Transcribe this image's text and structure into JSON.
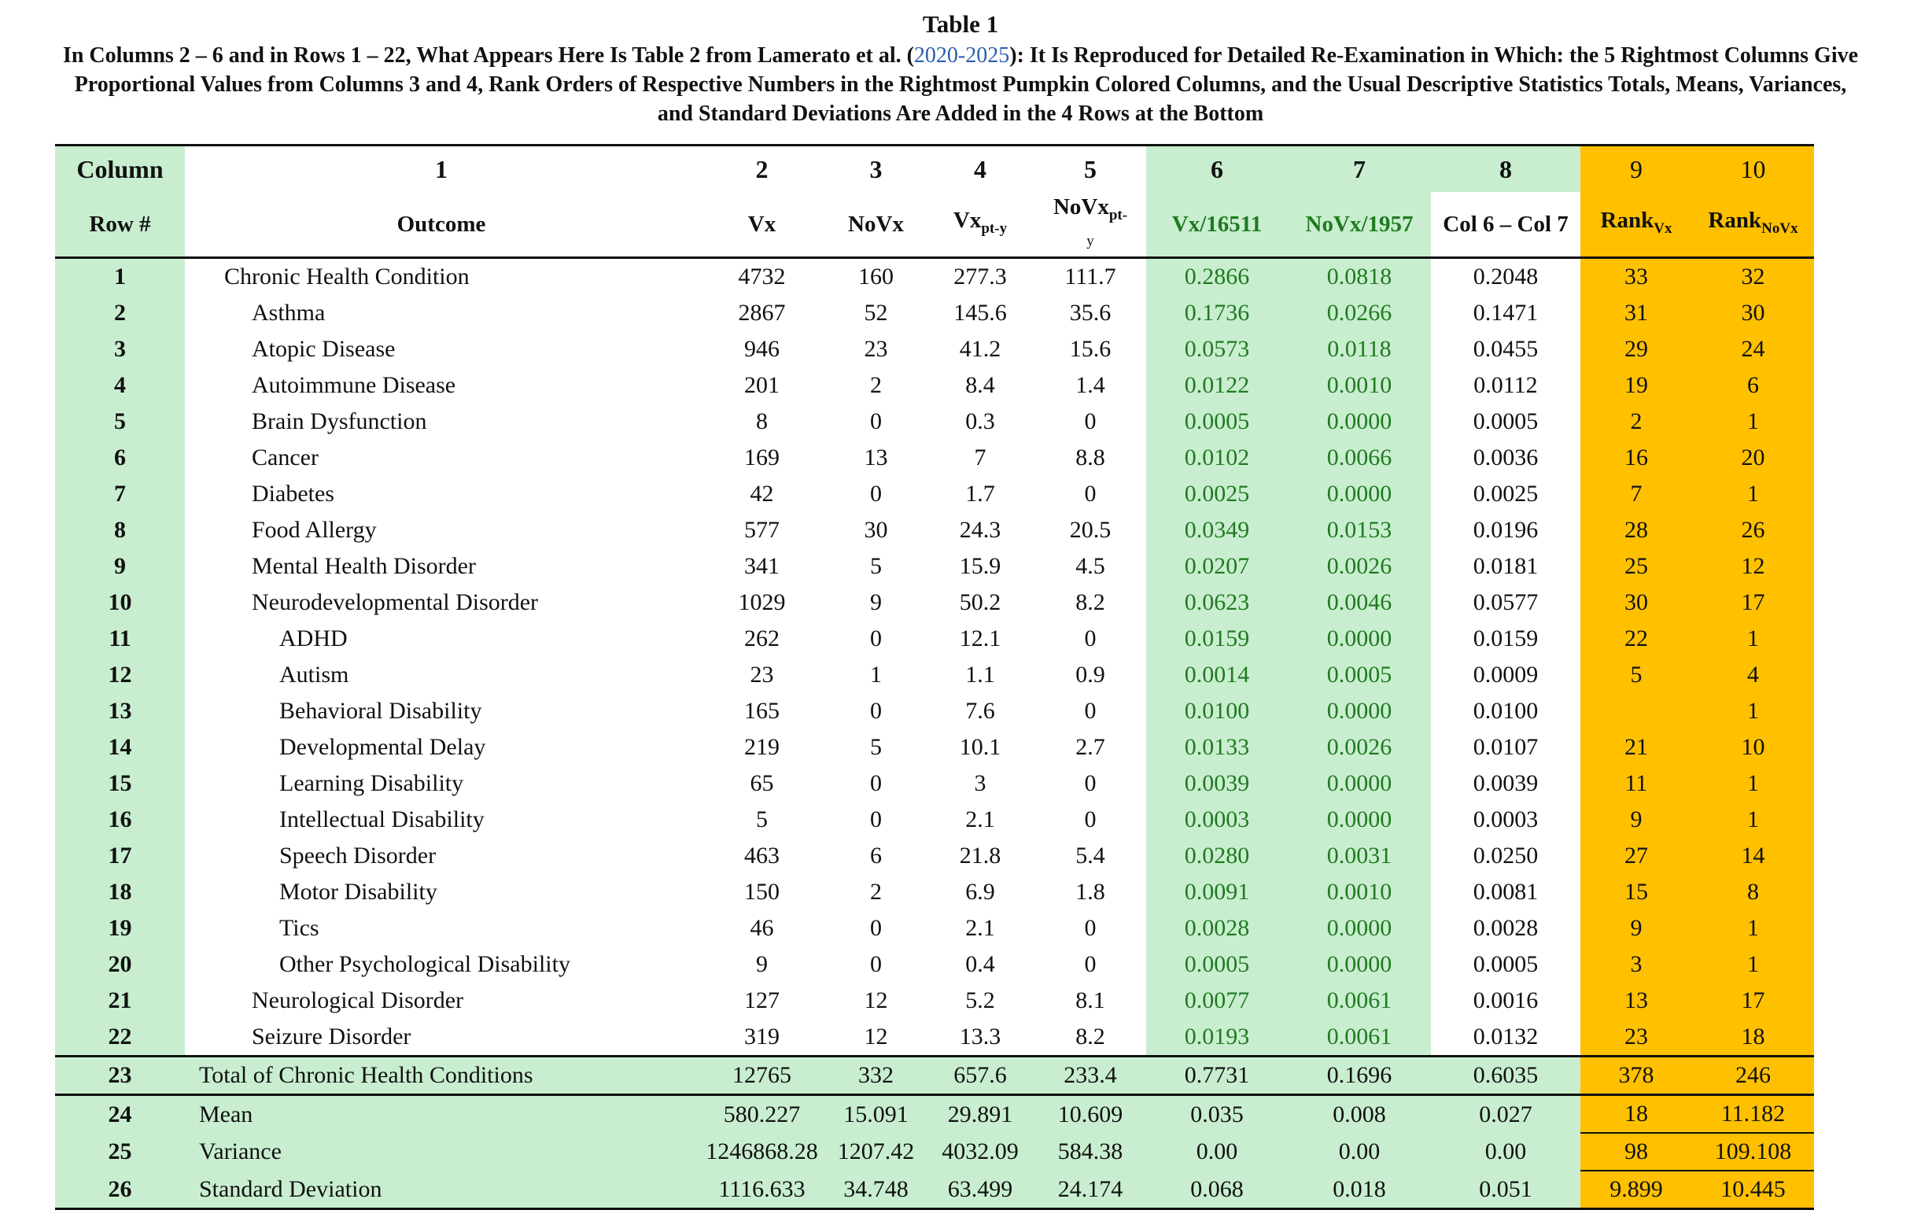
{
  "caption": {
    "title": "Table 1",
    "line_before_link": "In Columns 2 – 6 and in Rows 1 – 22,  What Appears Here Is Table 2 from Lamerato et al. (",
    "link": "2020-2025",
    "line_after_link": "): It Is Reproduced for Detailed Re-Examination in Which: the 5 Rightmost Columns Give Proportional Values from Columns 3 and 4, Rank Orders of Respective Numbers in the Rightmost Pumpkin Colored Columns, and the Usual Descriptive Statistics Totals, Means,  Variances, and Standard Deviations Are Added in the 4 Rows at the Bottom"
  },
  "header1": [
    "Column",
    "1",
    "2",
    "3",
    "4",
    "5",
    "6",
    "7",
    "8",
    "9",
    "10"
  ],
  "header2": {
    "row": "Row #",
    "outcome": "Outcome",
    "vx": "Vx",
    "novx": "NoVx",
    "vxpty_main": "Vx",
    "vxpty_sub": "pt-y",
    "novxpty_main": "NoVx",
    "novxpty_sub": "pt-",
    "novxpty_tail": "y",
    "c6": "Vx/16511",
    "c7": "NoVx/1957",
    "c8": "Col 6 – Col 7",
    "rank_main": "Rank",
    "rank_vx_sub": "Vx",
    "rank_novx_sub": "NoVx"
  },
  "rows": [
    {
      "n": "1",
      "outcome": "Chronic Health Condition",
      "indent": 1,
      "c2": "4732",
      "c3": "160",
      "c4": "277.3",
      "c5": "111.7",
      "c6": "0.2866",
      "c7": "0.0818",
      "c8": "0.2048",
      "c9": "33",
      "c10": "32"
    },
    {
      "n": "2",
      "outcome": "Asthma",
      "indent": 2,
      "c2": "2867",
      "c3": "52",
      "c4": "145.6",
      "c5": "35.6",
      "c6": "0.1736",
      "c7": "0.0266",
      "c8": "0.1471",
      "c9": "31",
      "c10": "30"
    },
    {
      "n": "3",
      "outcome": "Atopic Disease",
      "indent": 2,
      "c2": "946",
      "c3": "23",
      "c4": "41.2",
      "c5": "15.6",
      "c6": "0.0573",
      "c7": "0.0118",
      "c8": "0.0455",
      "c9": "29",
      "c10": "24"
    },
    {
      "n": "4",
      "outcome": "Autoimmune Disease",
      "indent": 2,
      "c2": "201",
      "c3": "2",
      "c4": "8.4",
      "c5": "1.4",
      "c6": "0.0122",
      "c7": "0.0010",
      "c8": "0.0112",
      "c9": "19",
      "c10": "6"
    },
    {
      "n": "5",
      "outcome": "Brain Dysfunction",
      "indent": 2,
      "c2": "8",
      "c3": "0",
      "c4": "0.3",
      "c5": "0",
      "c6": "0.0005",
      "c7": "0.0000",
      "c8": "0.0005",
      "c9": "2",
      "c10": "1"
    },
    {
      "n": "6",
      "outcome": "Cancer",
      "indent": 2,
      "c2": "169",
      "c3": "13",
      "c4": "7",
      "c5": "8.8",
      "c6": "0.0102",
      "c7": "0.0066",
      "c8": "0.0036",
      "c9": "16",
      "c10": "20"
    },
    {
      "n": "7",
      "outcome": "Diabetes",
      "indent": 2,
      "c2": "42",
      "c3": "0",
      "c4": "1.7",
      "c5": "0",
      "c6": "0.0025",
      "c7": "0.0000",
      "c8": "0.0025",
      "c9": "7",
      "c10": "1"
    },
    {
      "n": "8",
      "outcome": "Food Allergy",
      "indent": 2,
      "c2": "577",
      "c3": "30",
      "c4": "24.3",
      "c5": "20.5",
      "c6": "0.0349",
      "c7": "0.0153",
      "c8": "0.0196",
      "c9": "28",
      "c10": "26"
    },
    {
      "n": "9",
      "outcome": "Mental Health Disorder",
      "indent": 2,
      "c2": "341",
      "c3": "5",
      "c4": "15.9",
      "c5": "4.5",
      "c6": "0.0207",
      "c7": "0.0026",
      "c8": "0.0181",
      "c9": "25",
      "c10": "12"
    },
    {
      "n": "10",
      "outcome": "Neurodevelopmental Disorder",
      "indent": 2,
      "c2": "1029",
      "c3": "9",
      "c4": "50.2",
      "c5": "8.2",
      "c6": "0.0623",
      "c7": "0.0046",
      "c8": "0.0577",
      "c9": "30",
      "c10": "17"
    },
    {
      "n": "11",
      "outcome": "ADHD",
      "indent": 3,
      "c2": "262",
      "c3": "0",
      "c4": "12.1",
      "c5": "0",
      "c6": "0.0159",
      "c7": "0.0000",
      "c8": "0.0159",
      "c9": "22",
      "c10": "1"
    },
    {
      "n": "12",
      "outcome": "Autism",
      "indent": 3,
      "c2": "23",
      "c3": "1",
      "c4": "1.1",
      "c5": "0.9",
      "c6": "0.0014",
      "c7": "0.0005",
      "c8": "0.0009",
      "c9": "5",
      "c10": "4"
    },
    {
      "n": "13",
      "outcome": "Behavioral Disability",
      "indent": 3,
      "c2": "165",
      "c3": "0",
      "c4": "7.6",
      "c5": "0",
      "c6": "0.0100",
      "c7": "0.0000",
      "c8": "0.0100",
      "c9": "",
      "c10": "1"
    },
    {
      "n": "14",
      "outcome": "Developmental Delay",
      "indent": 3,
      "c2": "219",
      "c3": "5",
      "c4": "10.1",
      "c5": "2.7",
      "c6": "0.0133",
      "c7": "0.0026",
      "c8": "0.0107",
      "c9": "21",
      "c10": "10"
    },
    {
      "n": "15",
      "outcome": "Learning Disability",
      "indent": 3,
      "c2": "65",
      "c3": "0",
      "c4": "3",
      "c5": "0",
      "c6": "0.0039",
      "c7": "0.0000",
      "c8": "0.0039",
      "c9": "11",
      "c10": "1"
    },
    {
      "n": "16",
      "outcome": "Intellectual Disability",
      "indent": 3,
      "c2": "5",
      "c3": "0",
      "c4": "2.1",
      "c5": "0",
      "c6": "0.0003",
      "c7": "0.0000",
      "c8": "0.0003",
      "c9": "9",
      "c10": "1"
    },
    {
      "n": "17",
      "outcome": "Speech Disorder",
      "indent": 3,
      "c2": "463",
      "c3": "6",
      "c4": "21.8",
      "c5": "5.4",
      "c6": "0.0280",
      "c7": "0.0031",
      "c8": "0.0250",
      "c9": "27",
      "c10": "14"
    },
    {
      "n": "18",
      "outcome": "Motor Disability",
      "indent": 3,
      "c2": "150",
      "c3": "2",
      "c4": "6.9",
      "c5": "1.8",
      "c6": "0.0091",
      "c7": "0.0010",
      "c8": "0.0081",
      "c9": "15",
      "c10": "8"
    },
    {
      "n": "19",
      "outcome": "Tics",
      "indent": 3,
      "c2": "46",
      "c3": "0",
      "c4": "2.1",
      "c5": "0",
      "c6": "0.0028",
      "c7": "0.0000",
      "c8": "0.0028",
      "c9": "9",
      "c10": "1"
    },
    {
      "n": "20",
      "outcome": "Other Psychological Disability",
      "indent": 3,
      "c2": "9",
      "c3": "0",
      "c4": "0.4",
      "c5": "0",
      "c6": "0.0005",
      "c7": "0.0000",
      "c8": "0.0005",
      "c9": "3",
      "c10": "1"
    },
    {
      "n": "21",
      "outcome": "Neurological Disorder",
      "indent": 2,
      "c2": "127",
      "c3": "12",
      "c4": "5.2",
      "c5": "8.1",
      "c6": "0.0077",
      "c7": "0.0061",
      "c8": "0.0016",
      "c9": "13",
      "c10": "17"
    },
    {
      "n": "22",
      "outcome": "Seizure Disorder",
      "indent": 2,
      "c2": "319",
      "c3": "12",
      "c4": "13.3",
      "c5": "8.2",
      "c6": "0.0193",
      "c7": "0.0061",
      "c8": "0.0132",
      "c9": "23",
      "c10": "18"
    }
  ],
  "summary": [
    {
      "n": "23",
      "outcome": "Total of Chronic Health Conditions",
      "c2": "12765",
      "c3": "332",
      "c4": "657.6",
      "c5": "233.4",
      "c6": "0.7731",
      "c7": "0.1696",
      "c8": "0.6035",
      "c9": "378",
      "c10": "246"
    },
    {
      "n": "24",
      "outcome": "Mean",
      "c2": "580.227",
      "c3": "15.091",
      "c4": "29.891",
      "c5": "10.609",
      "c6": "0.035",
      "c7": "0.008",
      "c8": "0.027",
      "c9": "18",
      "c10": "11.182"
    },
    {
      "n": "25",
      "outcome": "Variance",
      "c2": "1246868.28",
      "c3": "1207.42",
      "c4": "4032.09",
      "c5": "584.38",
      "c6": "0.00",
      "c7": "0.00",
      "c8": "0.00",
      "c9": "98",
      "c10": "109.108"
    },
    {
      "n": "26",
      "outcome": "Standard Deviation",
      "c2": "1116.633",
      "c3": "34.748",
      "c4": "63.499",
      "c5": "24.174",
      "c6": "0.068",
      "c7": "0.018",
      "c8": "0.051",
      "c9": "9.899",
      "c10": "10.445"
    }
  ],
  "colors": {
    "green": "#c8eecf",
    "orange": "#ffc000",
    "green_text": "#1f7a1f",
    "link": "#2a5db0"
  }
}
